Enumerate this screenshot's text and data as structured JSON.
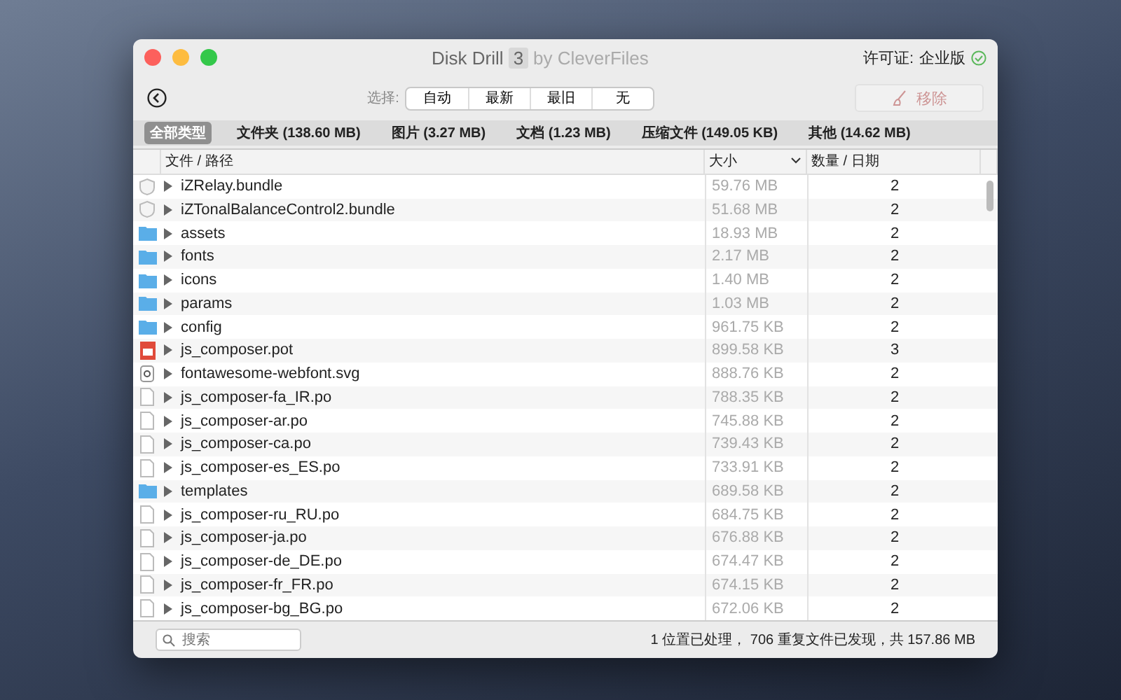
{
  "window": {
    "title": "Disk Drill",
    "version": "3",
    "subtitle": "by CleverFiles",
    "license_label": "许可证:",
    "license": "企业版"
  },
  "toolbar": {
    "select_label": "选择:",
    "select_options": [
      {
        "label": "自动",
        "selected": false
      },
      {
        "label": "最新",
        "selected": false
      },
      {
        "label": "最旧",
        "selected": false
      },
      {
        "label": "无",
        "selected": false
      }
    ],
    "remove_button": {
      "label": "移除",
      "disabled": true
    }
  },
  "type_tabs": [
    {
      "label": "全部类型",
      "selected": true
    },
    {
      "label": "文件夹 (138.60 MB)",
      "selected": false
    },
    {
      "label": "图片 (3.27 MB)",
      "selected": false
    },
    {
      "label": "文档 (1.23 MB)",
      "selected": false
    },
    {
      "label": "压缩文件 (149.05 KB)",
      "selected": false
    },
    {
      "label": "其他 (14.62 MB)",
      "selected": false
    }
  ],
  "table": {
    "columns": [
      "文件 / 路径",
      "大小",
      "数量 / 日期"
    ],
    "rows": [
      {
        "kind": "bundle",
        "name": "iZRelay.bundle",
        "size": "59.76 MB",
        "count": "2"
      },
      {
        "kind": "bundle",
        "name": "iZTonalBalanceControl2.bundle",
        "size": "51.68 MB",
        "count": "2"
      },
      {
        "kind": "folder",
        "name": "assets",
        "size": "18.93 MB",
        "count": "2"
      },
      {
        "kind": "folder",
        "name": "fonts",
        "size": "2.17 MB",
        "count": "2"
      },
      {
        "kind": "folder",
        "name": "icons",
        "size": "1.40 MB",
        "count": "2"
      },
      {
        "kind": "folder",
        "name": "params",
        "size": "1.03 MB",
        "count": "2"
      },
      {
        "kind": "folder",
        "name": "config",
        "size": "961.75 KB",
        "count": "2"
      },
      {
        "kind": "pot",
        "name": "js_composer.pot",
        "size": "899.58 KB",
        "count": "3"
      },
      {
        "kind": "font",
        "name": "fontawesome-webfont.svg",
        "size": "888.76 KB",
        "count": "2"
      },
      {
        "kind": "file",
        "name": "js_composer-fa_IR.po",
        "size": "788.35 KB",
        "count": "2"
      },
      {
        "kind": "file",
        "name": "js_composer-ar.po",
        "size": "745.88 KB",
        "count": "2"
      },
      {
        "kind": "file",
        "name": "js_composer-ca.po",
        "size": "739.43 KB",
        "count": "2"
      },
      {
        "kind": "file",
        "name": "js_composer-es_ES.po",
        "size": "733.91 KB",
        "count": "2"
      },
      {
        "kind": "folder",
        "name": "templates",
        "size": "689.58 KB",
        "count": "2"
      },
      {
        "kind": "file",
        "name": "js_composer-ru_RU.po",
        "size": "684.75 KB",
        "count": "2"
      },
      {
        "kind": "file",
        "name": "js_composer-ja.po",
        "size": "676.88 KB",
        "count": "2"
      },
      {
        "kind": "file",
        "name": "js_composer-de_DE.po",
        "size": "674.47 KB",
        "count": "2"
      },
      {
        "kind": "file",
        "name": "js_composer-fr_FR.po",
        "size": "674.15 KB",
        "count": "2"
      },
      {
        "kind": "file",
        "name": "js_composer-bg_BG.po",
        "size": "672.06 KB",
        "count": "2"
      }
    ]
  },
  "footer": {
    "search_placeholder": "搜索",
    "status": "1 位置已处理， 706 重复文件已发现，共 157.86 MB"
  }
}
